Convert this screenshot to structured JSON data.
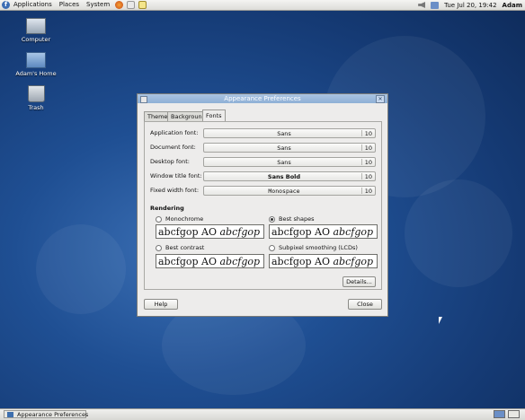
{
  "top_panel": {
    "menus": [
      "Applications",
      "Places",
      "System"
    ],
    "clock": "Tue Jul 20, 19:42",
    "user": "Adam"
  },
  "desktop_icons": [
    {
      "label": "Computer",
      "icon": "computer-icon"
    },
    {
      "label": "Adam's Home",
      "icon": "home-folder-icon"
    },
    {
      "label": "Trash",
      "icon": "trash-icon"
    }
  ],
  "window": {
    "title": "Appearance Preferences",
    "tabs": [
      "Theme",
      "Background",
      "Fonts"
    ],
    "active_tab": "Fonts",
    "fonts": [
      {
        "label": "Application font:",
        "font": "Sans",
        "size": "10"
      },
      {
        "label": "Document font:",
        "font": "Sans",
        "size": "10"
      },
      {
        "label": "Desktop font:",
        "font": "Sans",
        "size": "10"
      },
      {
        "label": "Window title font:",
        "font": "Sans Bold",
        "size": "10"
      },
      {
        "label": "Fixed width font:",
        "font": "Monospace",
        "size": "10"
      }
    ],
    "rendering": {
      "heading": "Rendering",
      "options": [
        {
          "label": "Monochrome",
          "checked": false
        },
        {
          "label": "Best shapes",
          "checked": true
        },
        {
          "label": "Best contrast",
          "checked": false
        },
        {
          "label": "Subpixel smoothing (LCDs)",
          "checked": false
        }
      ],
      "sample_normal": "abcfgop AO ",
      "sample_italic": "abcfgop"
    },
    "details_button": "Details...",
    "help_button": "Help",
    "close_button": "Close"
  },
  "bottom_panel": {
    "task_label": "Appearance Preferences"
  }
}
